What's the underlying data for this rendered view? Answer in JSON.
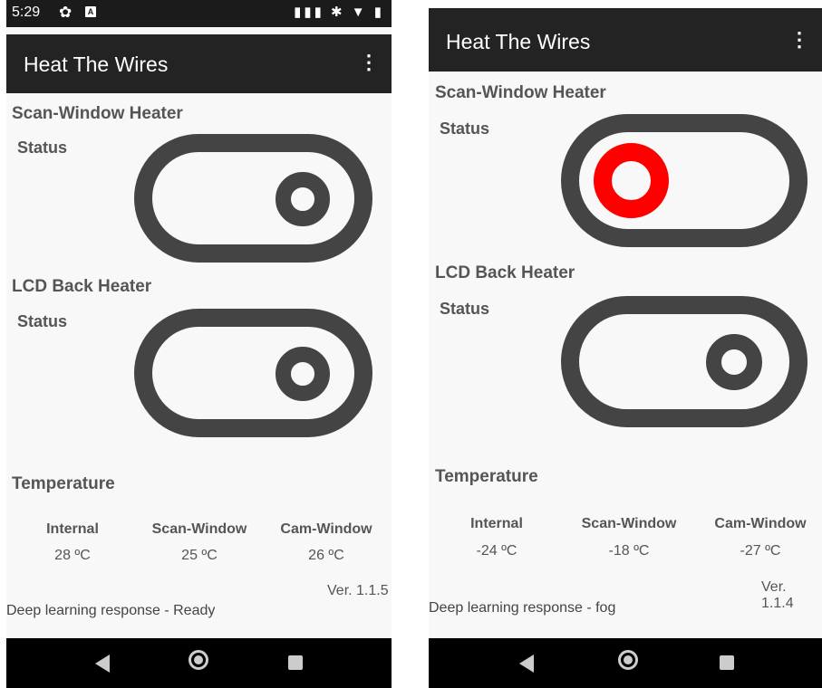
{
  "left": {
    "statusbar": {
      "time": "5:29",
      "gear_icon": "gear-icon",
      "badge": "A",
      "system_icons": "▮▮▮ ✱ ▼ ▮"
    },
    "appbar": {
      "title": "Heat The Wires",
      "menu": "⋮"
    },
    "scan_heater": {
      "title": "Scan-Window Heater",
      "status_label": "Status",
      "state": "off"
    },
    "lcd_heater": {
      "title": "LCD Back Heater",
      "status_label": "Status",
      "state": "off"
    },
    "temperature": {
      "title": "Temperature",
      "headers": [
        "Internal",
        "Scan-Window",
        "Cam-Window"
      ],
      "values": [
        "28 ºC",
        "25 ºC",
        "26 ºC"
      ]
    },
    "version": "Ver. 1.1.5",
    "response": "Deep learning response - Ready"
  },
  "right": {
    "appbar": {
      "title": "Heat The Wires",
      "menu": "⋮"
    },
    "scan_heater": {
      "title": "Scan-Window Heater",
      "status_label": "Status",
      "state": "on"
    },
    "lcd_heater": {
      "title": "LCD Back Heater",
      "status_label": "Status",
      "state": "off"
    },
    "temperature": {
      "title": "Temperature",
      "headers": [
        "Internal",
        "Scan-Window",
        "Cam-Window"
      ],
      "values": [
        "-24 ºC",
        "-18 ºC",
        "-27 ºC"
      ]
    },
    "version": "Ver. 1.1.4",
    "response": "Deep learning response - fog"
  },
  "colors": {
    "toggle": "#444444",
    "knob_off": "#444444",
    "knob_on": "#ff0000",
    "appbar": "#232323"
  }
}
